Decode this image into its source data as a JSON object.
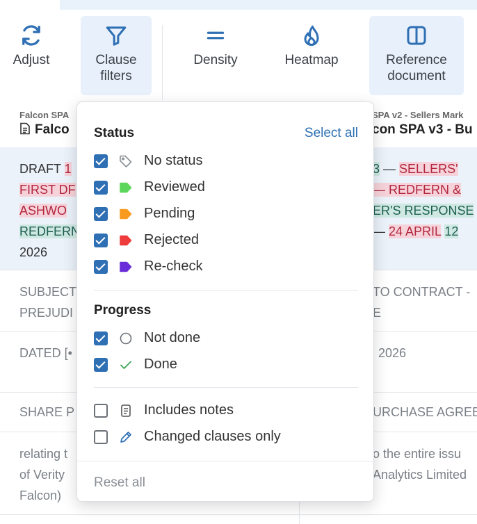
{
  "toolbar": {
    "buttons": [
      {
        "label": "Adjust",
        "icon": "refresh-icon"
      },
      {
        "label": "Clause\nfilters",
        "icon": "filter-icon",
        "active": true
      },
      {
        "label": "Density",
        "icon": "equals-icon"
      },
      {
        "label": "Heatmap",
        "icon": "flame-icon"
      },
      {
        "label": "Reference\ndocument",
        "icon": "split-view-icon",
        "active": true
      }
    ]
  },
  "columns": {
    "left": {
      "subtitle": "Falcon SPA",
      "title": "Falco"
    },
    "right": {
      "subtitle": "SPA v2 - Sellers Mark",
      "title": "con SPA v3 - Bu"
    }
  },
  "rows": {
    "r1": {
      "left": [
        "DRAFT ",
        "1",
        "FIRST DF",
        "ASHWO",
        "REDFERN",
        "2026"
      ],
      "right": [
        "3",
        " — ",
        "SELLERS'",
        " — REDFERN &",
        "ER'S RESPONSE",
        " — ",
        "24 APRIL",
        " ",
        "12"
      ]
    },
    "r2": {
      "left": [
        "SUBJECT",
        "PREJUDI"
      ],
      "right": [
        "TO CONTRACT -",
        "E"
      ]
    },
    "r3": {
      "left": [
        "DATED [•"
      ],
      "right": [
        "2026"
      ]
    },
    "r4": {
      "left": [
        "SHARE P"
      ],
      "right": [
        "URCHASE AGREE"
      ]
    },
    "r5": {
      "left": [
        "relating t",
        "of Verity",
        "Falcon)"
      ],
      "right": [
        "o the entire issu",
        "Analytics Limited"
      ]
    }
  },
  "popover": {
    "status_title": "Status",
    "select_all": "Select all",
    "status_items": [
      {
        "label": "No status",
        "checked": true,
        "icon": "tag-outline-icon",
        "color": "#8a8f96"
      },
      {
        "label": "Reviewed",
        "checked": true,
        "icon": "tag-green-icon",
        "color": "#5cd65c"
      },
      {
        "label": "Pending",
        "checked": true,
        "icon": "tag-orange-icon",
        "color": "#f79a1e"
      },
      {
        "label": "Rejected",
        "checked": true,
        "icon": "tag-red-icon",
        "color": "#ee3b3b"
      },
      {
        "label": "Re-check",
        "checked": true,
        "icon": "tag-purple-icon",
        "color": "#6a2bd9"
      }
    ],
    "progress_title": "Progress",
    "progress_items": [
      {
        "label": "Not done",
        "checked": true,
        "icon": "circle-icon"
      },
      {
        "label": "Done",
        "checked": true,
        "icon": "check-icon",
        "color": "#3aa55a"
      }
    ],
    "extra_items": [
      {
        "label": "Includes notes",
        "checked": false,
        "icon": "note-icon"
      },
      {
        "label": "Changed clauses only",
        "checked": false,
        "icon": "pencil-icon",
        "color": "#2f6fb4"
      }
    ],
    "reset": "Reset all"
  },
  "colors": {
    "accent": "#2f6fb4",
    "deletion": "#b3263e",
    "insertion": "#1d5e53",
    "highlight_row": "#ebf2fa"
  }
}
